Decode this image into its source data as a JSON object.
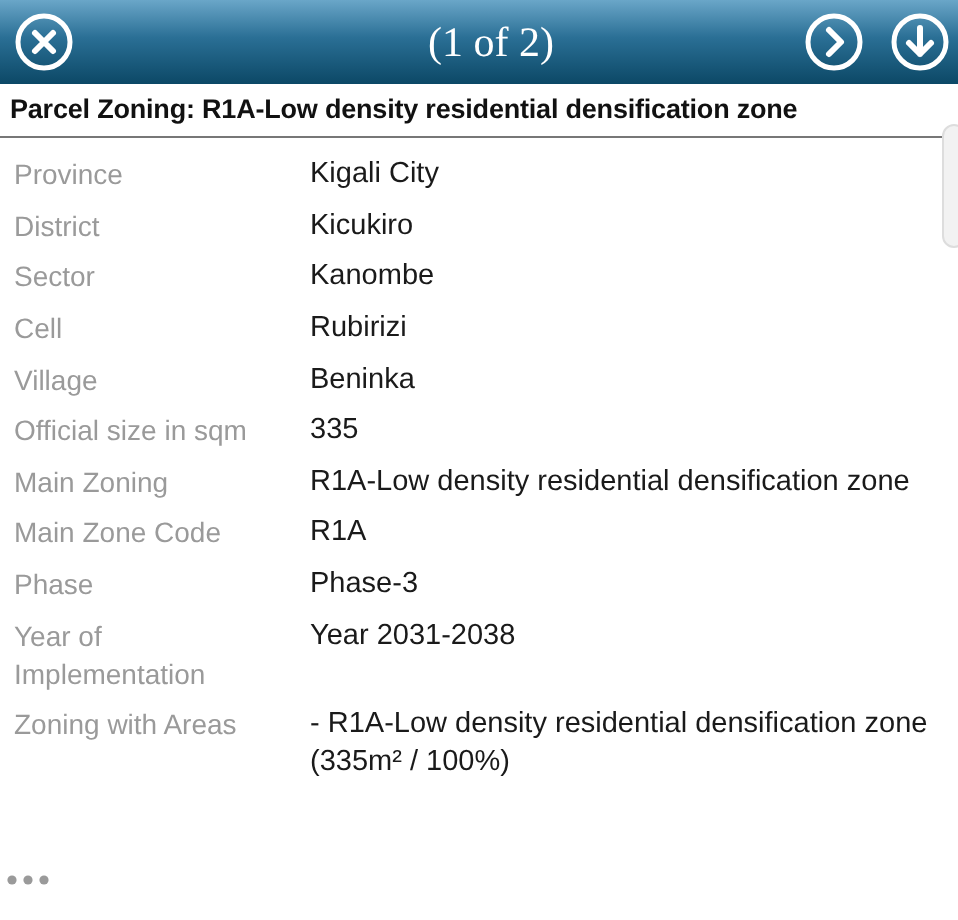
{
  "header": {
    "counter": "(1 of 2)"
  },
  "title": "Parcel Zoning: R1A-Low density residential densification zone",
  "fields": [
    {
      "label": "Province",
      "value": "Kigali City"
    },
    {
      "label": "District",
      "value": "Kicukiro"
    },
    {
      "label": "Sector",
      "value": "Kanombe"
    },
    {
      "label": "Cell",
      "value": "Rubirizi"
    },
    {
      "label": "Village",
      "value": "Beninka"
    },
    {
      "label": "Official size in sqm",
      "value": "335"
    },
    {
      "label": "Main Zoning",
      "value": "R1A-Low density residential densification zone"
    },
    {
      "label": "Main Zone Code",
      "value": "R1A"
    },
    {
      "label": "Phase",
      "value": "Phase-3"
    },
    {
      "label": "Year of Implementation",
      "value": "Year 2031-2038"
    },
    {
      "label": "Zoning with Areas",
      "value": "- R1A-Low density residential densification zone (335m² / 100%)"
    }
  ]
}
